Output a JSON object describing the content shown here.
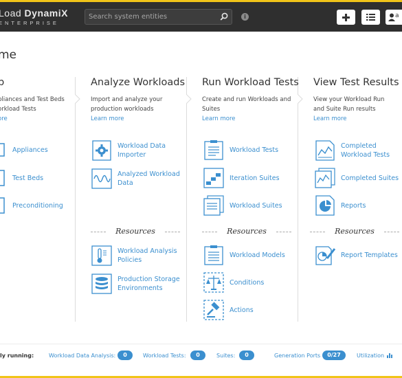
{
  "header": {
    "brand_line1_plain": "Load ",
    "brand_line1_bold": "DynamiX",
    "brand_line2": "ENTERPRISE",
    "search_placeholder": "Search system entities",
    "user_label": "a"
  },
  "page_title": "me",
  "columns": [
    {
      "title": "p",
      "desc1": "pliances and Test Beds",
      "desc2": "orkload Tests",
      "learn": "ore",
      "items": [
        {
          "label1": "Appliances",
          "label2": "",
          "icon": "appliance-icon"
        },
        {
          "label1": "Test Beds",
          "label2": "",
          "icon": "test-bed-icon"
        },
        {
          "label1": "Preconditioning",
          "label2": "",
          "icon": "preconditioning-icon"
        }
      ]
    },
    {
      "title": "Analyze Workloads",
      "desc1": "Import and analyze your",
      "desc2": "production workloads",
      "learn": "Learn more",
      "items": [
        {
          "label1": "Workload Data",
          "label2": "Importer",
          "icon": "gear-document-icon"
        },
        {
          "label1": "Analyzed Workload",
          "label2": "Data",
          "icon": "waveform-icon"
        }
      ],
      "resources_label": "Resources",
      "resources": [
        {
          "label1": "Workload Analysis",
          "label2": "Policies",
          "icon": "thermometer-icon"
        },
        {
          "label1": "Production Storage",
          "label2": "Environments",
          "icon": "database-icon"
        }
      ]
    },
    {
      "title": "Run Workload Tests",
      "desc1": "Create and run Workloads and",
      "desc2": "Suites",
      "learn": "Learn more",
      "items": [
        {
          "label1": "Workload Tests",
          "label2": "",
          "icon": "clipboard-icon"
        },
        {
          "label1": "Iteration Suites",
          "label2": "",
          "icon": "steps-icon"
        },
        {
          "label1": "Workload Suites",
          "label2": "",
          "icon": "stacked-clipboard-icon"
        }
      ],
      "resources_label": "Resources",
      "resources": [
        {
          "label1": "Workload Models",
          "label2": "",
          "icon": "model-clipboard-icon"
        },
        {
          "label1": "Conditions",
          "label2": "",
          "icon": "scale-icon"
        },
        {
          "label1": "Actions",
          "label2": "",
          "icon": "gavel-icon"
        }
      ]
    },
    {
      "title": "View Test Results",
      "desc1": "View your Workload Run",
      "desc2": "and Suite Run results",
      "learn": "Learn more",
      "items": [
        {
          "label1": "Completed",
          "label2": "Workload Tests",
          "icon": "line-chart-doc-icon"
        },
        {
          "label1": "Completed Suites",
          "label2": "",
          "icon": "stacked-chart-doc-icon"
        },
        {
          "label1": "Reports",
          "label2": "",
          "icon": "pie-chart-doc-icon"
        }
      ],
      "resources_label": "Resources",
      "resources": [
        {
          "label1": "Report Templates",
          "label2": "",
          "icon": "chart-pencil-icon"
        }
      ]
    }
  ],
  "footer": {
    "running_label": "ly running:",
    "workload_data_analysis_label": "Workload Data Analysis:",
    "workload_data_analysis_count": "0",
    "workload_tests_label": "Workload Tests:",
    "workload_tests_count": "0",
    "suites_label": "Suites:",
    "suites_count": "0",
    "generation_ports_label": "Generation Ports",
    "generation_ports_value": "0/27",
    "utilization_label": "Utilization"
  },
  "colors": {
    "accent": "#3b8fcf",
    "topbar": "#2f2f2f",
    "highlight": "#f0c419"
  }
}
